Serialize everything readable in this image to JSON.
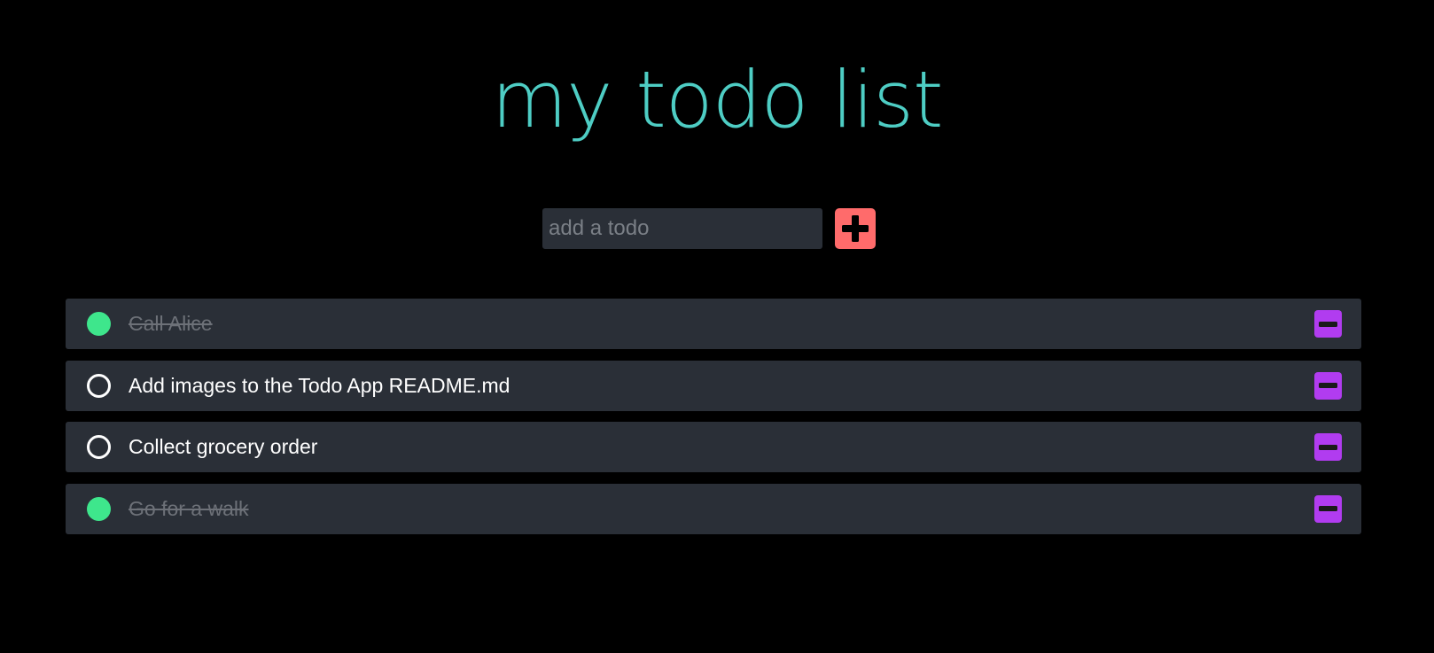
{
  "header": {
    "title": "my todo list"
  },
  "add_form": {
    "placeholder": "add a todo",
    "value": "",
    "add_icon": "plus-icon"
  },
  "colors": {
    "background": "#000000",
    "title": "#4ecdc4",
    "row_background": "#2a2f37",
    "add_button": "#ff6b6b",
    "remove_button": "#b13cf0",
    "done_check": "#3ee68c"
  },
  "todos": [
    {
      "text": "Call Alice",
      "done": true,
      "remove_icon": "minus-icon"
    },
    {
      "text": "Add images to the Todo App README.md",
      "done": false,
      "remove_icon": "minus-icon"
    },
    {
      "text": "Collect grocery order",
      "done": false,
      "remove_icon": "minus-icon"
    },
    {
      "text": "Go for a walk",
      "done": true,
      "remove_icon": "minus-icon"
    }
  ]
}
